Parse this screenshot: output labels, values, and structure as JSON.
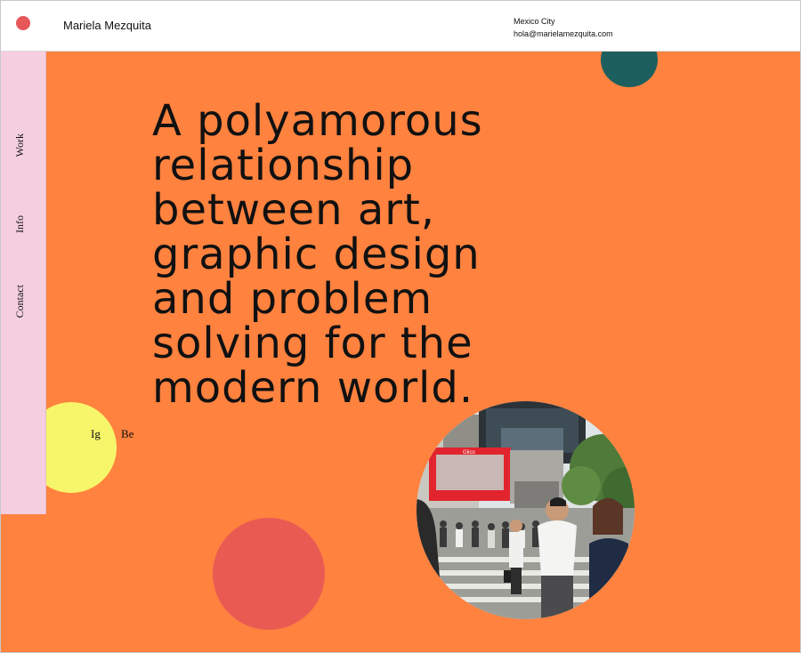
{
  "header": {
    "site_name": "Mariela Mezquita",
    "location": "Mexico City",
    "email": "hola@marielamezquita.com"
  },
  "nav": {
    "items": [
      {
        "label": "Work"
      },
      {
        "label": "Info"
      },
      {
        "label": "Contact"
      }
    ]
  },
  "social": {
    "instagram": "Ig",
    "behance": "Be"
  },
  "hero": {
    "lines": [
      "A polyamorous",
      "relationship",
      "between art,",
      "graphic design",
      "and problem",
      "solving for the",
      "modern world."
    ],
    "photo_billboard_text": "Glico"
  },
  "colors": {
    "hero_background": "#ff823f",
    "sidebar": "#f5cfe0",
    "logo_dot": "#e8575a",
    "teal_circle": "#1d5f5e",
    "yellow_circle": "#f7f66a",
    "coral_circle": "#e95b52",
    "text": "#111111"
  }
}
